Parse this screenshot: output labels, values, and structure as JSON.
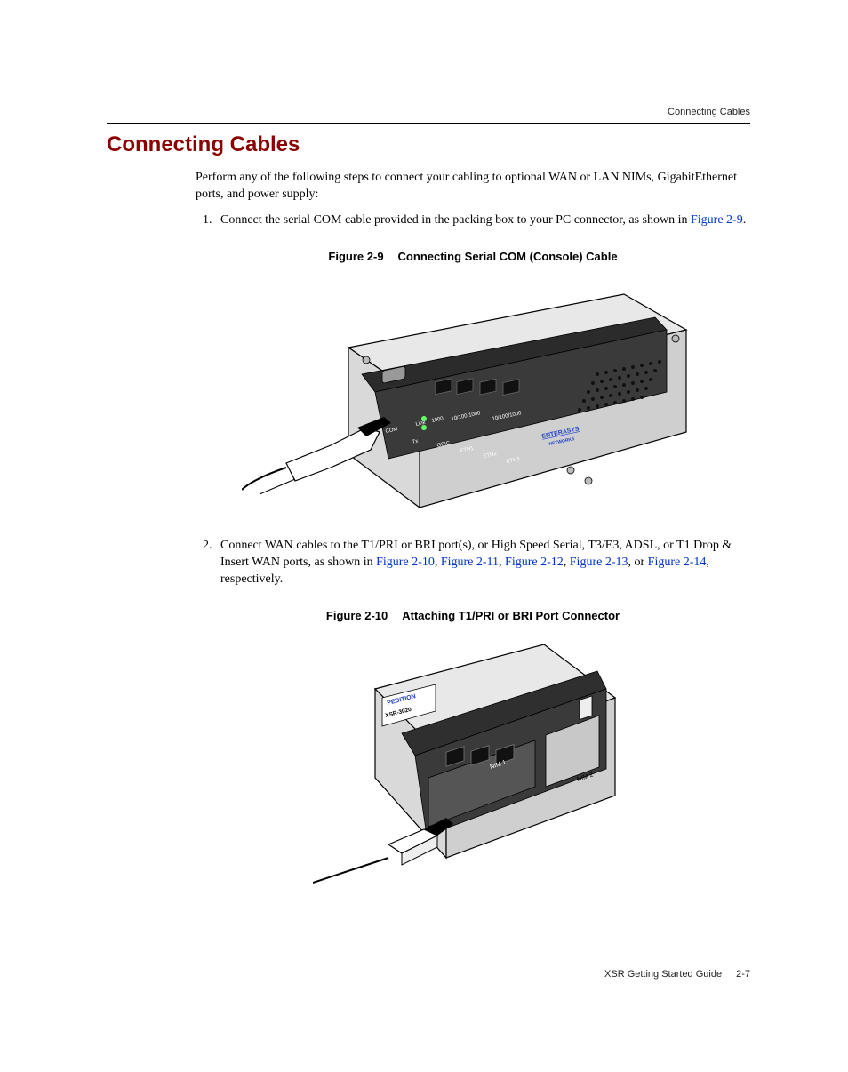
{
  "running_head": "Connecting Cables",
  "section_title": "Connecting Cables",
  "intro_para": "Perform any of the following steps to connect your cabling to optional WAN or LAN NIMs, GigabitEthernet ports, and power supply:",
  "step1": {
    "prefix": "Connect the serial COM cable provided in the packing box to your PC connector, as shown in ",
    "link": "Figure 2-9",
    "suffix": "."
  },
  "figure1": {
    "label": "Figure 2-9",
    "title": "Connecting Serial COM (Console) Cable",
    "labels": {
      "com": "COM",
      "link": "Link",
      "1000": "1000",
      "101001000a": "10/100/1000",
      "101001000b": "10/100/1000",
      "tx": "Tx",
      "gbic": "GBIC",
      "eth1": "ETH1",
      "eth2": "ETH2",
      "eth3": "ETH3",
      "brand": "ENTERASYS",
      "brand2": "NETWORKS"
    }
  },
  "step2": {
    "prefix": "Connect WAN cables to the T1/PRI or BRI port(s), or High Speed Serial, T3/E3, ADSL, or T1 Drop & Insert WAN ports, as shown in ",
    "l1": "Figure 2-10",
    "c1": ", ",
    "l2": "Figure 2-11",
    "c2": ", ",
    "l3": "Figure 2-12",
    "c3": ", ",
    "l4": "Figure 2-13",
    "c4": ", or ",
    "l5": "Figure 2-14",
    "suffix": ", respectively."
  },
  "figure2": {
    "label": "Figure 2-10",
    "title": "Attaching T1/PRI or BRI Port Connector",
    "labels": {
      "pedition": "PEDITION",
      "model": "XSR-3020",
      "nim1": "NIM 1",
      "nim2": "NIM 2"
    }
  },
  "footer": {
    "book": "XSR Getting Started Guide",
    "page": "2-7"
  }
}
